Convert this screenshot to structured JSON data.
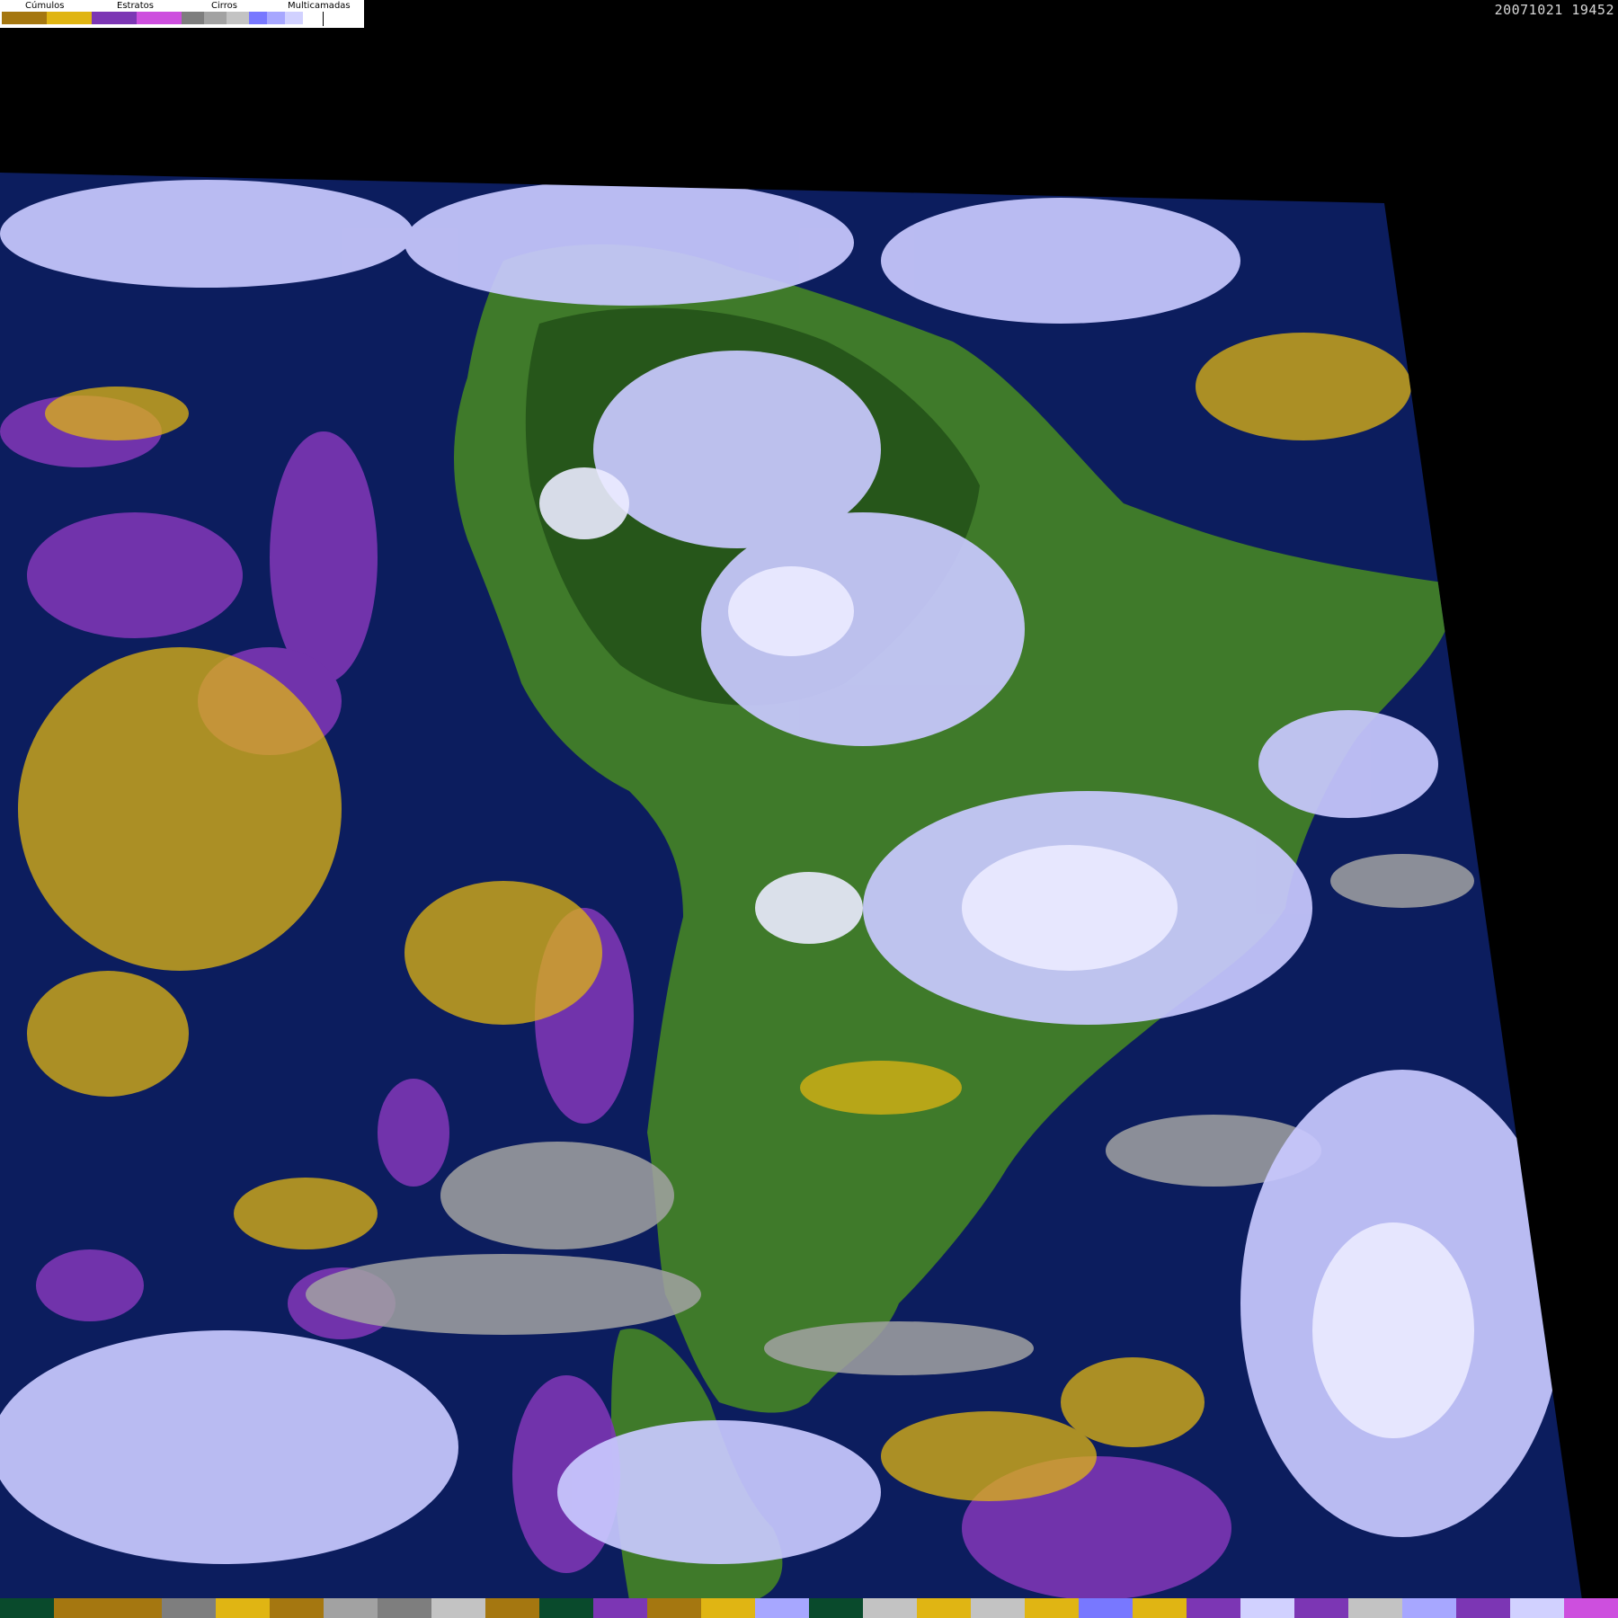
{
  "timestamp": "20071021 19452",
  "legend": {
    "groups": [
      {
        "label": "Cúmulos",
        "colors": [
          "#a57710",
          "#e0b513"
        ]
      },
      {
        "label": "Estratos",
        "colors": [
          "#7c36b4",
          "#cd4fde"
        ]
      },
      {
        "label": "Cirros",
        "colors": [
          "#7e7e7e",
          "#a2a2a2",
          "#c3c3c3"
        ]
      },
      {
        "label": "Multicamadas",
        "colors": [
          "#7878ff",
          "#a7a7ff",
          "#d1d1ff",
          "#ffffff"
        ]
      }
    ]
  },
  "colors": {
    "ocean": "#0c1d5e",
    "land": "#3f7a2a",
    "land_dark": "#26561a",
    "cumulus": "#e0b513",
    "stratus": "#7c36b4",
    "cirrus": "#a2a2a2",
    "multilayer": "#c9c9ff",
    "multilayer_bright": "#ebebff",
    "background": "#000000"
  },
  "bottom_strip_colors": [
    "#094a2c",
    "#a57710",
    "#a57710",
    "#7e7e7e",
    "#e0b513",
    "#a57710",
    "#a2a2a2",
    "#7e7e7e",
    "#c3c3c3",
    "#a57710",
    "#094a2c",
    "#7c36b4",
    "#a57710",
    "#e0b513",
    "#a7a7ff",
    "#094a2c",
    "#c3c3c3",
    "#e0b513",
    "#c3c3c3",
    "#e0b513",
    "#7878ff",
    "#e0b513",
    "#7c36b4",
    "#d1d1ff",
    "#7c36b4",
    "#c3c3c3",
    "#a7a7ff",
    "#7c36b4",
    "#d1d1ff",
    "#cd4fde"
  ]
}
